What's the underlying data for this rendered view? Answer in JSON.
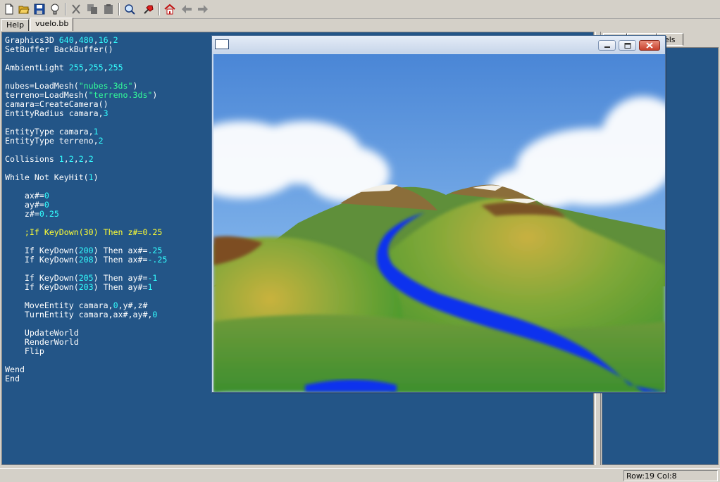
{
  "toolbar": {
    "buttons": [
      "new-file-icon",
      "open-folder-icon",
      "save-icon",
      "lightbulb-icon",
      "cut-icon",
      "copy-icon",
      "paste-icon",
      "find-icon",
      "run-icon",
      "home-icon",
      "back-arrow-icon",
      "forward-arrow-icon"
    ]
  },
  "tabs": [
    {
      "label": "Help"
    },
    {
      "label": "vuelo.bb"
    }
  ],
  "right_panel": {
    "tab_label": "bels"
  },
  "editor": {
    "lines": [
      [
        {
          "t": "Graphics3D ",
          "c": "kw"
        },
        {
          "t": "640",
          "c": "num"
        },
        {
          "t": ",",
          "c": "kw"
        },
        {
          "t": "480",
          "c": "num"
        },
        {
          "t": ",",
          "c": "kw"
        },
        {
          "t": "16",
          "c": "num"
        },
        {
          "t": ",",
          "c": "kw"
        },
        {
          "t": "2",
          "c": "num"
        }
      ],
      [
        {
          "t": "SetBuffer BackBuffer()",
          "c": "kw"
        }
      ],
      [],
      [
        {
          "t": "AmbientLight ",
          "c": "kw"
        },
        {
          "t": "255",
          "c": "num"
        },
        {
          "t": ",",
          "c": "kw"
        },
        {
          "t": "255",
          "c": "num"
        },
        {
          "t": ",",
          "c": "kw"
        },
        {
          "t": "255",
          "c": "num"
        }
      ],
      [],
      [
        {
          "t": "nubes=LoadMesh(",
          "c": "kw"
        },
        {
          "t": "\"nubes.3ds\"",
          "c": "str"
        },
        {
          "t": ")",
          "c": "kw"
        }
      ],
      [
        {
          "t": "terreno=LoadMesh(",
          "c": "kw"
        },
        {
          "t": "\"terreno.3ds\"",
          "c": "str"
        },
        {
          "t": ")",
          "c": "kw"
        }
      ],
      [
        {
          "t": "camara=CreateCamera()",
          "c": "kw"
        }
      ],
      [
        {
          "t": "EntityRadius camara,",
          "c": "kw"
        },
        {
          "t": "3",
          "c": "num"
        }
      ],
      [],
      [
        {
          "t": "EntityType camara,",
          "c": "kw"
        },
        {
          "t": "1",
          "c": "num"
        }
      ],
      [
        {
          "t": "EntityType terreno,",
          "c": "kw"
        },
        {
          "t": "2",
          "c": "num"
        }
      ],
      [],
      [
        {
          "t": "Collisions ",
          "c": "kw"
        },
        {
          "t": "1",
          "c": "num"
        },
        {
          "t": ",",
          "c": "kw"
        },
        {
          "t": "2",
          "c": "num"
        },
        {
          "t": ",",
          "c": "kw"
        },
        {
          "t": "2",
          "c": "num"
        },
        {
          "t": ",",
          "c": "kw"
        },
        {
          "t": "2",
          "c": "num"
        }
      ],
      [],
      [
        {
          "t": "While Not KeyHit(",
          "c": "kw"
        },
        {
          "t": "1",
          "c": "num"
        },
        {
          "t": ")",
          "c": "kw"
        }
      ],
      [],
      [
        {
          "t": "    ax#=",
          "c": "kw"
        },
        {
          "t": "0",
          "c": "num"
        }
      ],
      [
        {
          "t": "    ay#=",
          "c": "kw"
        },
        {
          "t": "0",
          "c": "num"
        }
      ],
      [
        {
          "t": "    z#=",
          "c": "kw"
        },
        {
          "t": "0.25",
          "c": "num"
        }
      ],
      [],
      [
        {
          "t": "    ;If KeyDown(30) Then z#=0.25",
          "c": "cmt"
        }
      ],
      [],
      [
        {
          "t": "    If KeyDown(",
          "c": "kw"
        },
        {
          "t": "200",
          "c": "num"
        },
        {
          "t": ") Then ax#=",
          "c": "kw"
        },
        {
          "t": ".25",
          "c": "num"
        }
      ],
      [
        {
          "t": "    If KeyDown(",
          "c": "kw"
        },
        {
          "t": "208",
          "c": "num"
        },
        {
          "t": ") Then ax#=",
          "c": "kw"
        },
        {
          "t": "-.25",
          "c": "num"
        }
      ],
      [],
      [
        {
          "t": "    If KeyDown(",
          "c": "kw"
        },
        {
          "t": "205",
          "c": "num"
        },
        {
          "t": ") Then ay#=",
          "c": "kw"
        },
        {
          "t": "-1",
          "c": "num"
        }
      ],
      [
        {
          "t": "    If KeyDown(",
          "c": "kw"
        },
        {
          "t": "203",
          "c": "num"
        },
        {
          "t": ") Then ay#=",
          "c": "kw"
        },
        {
          "t": "1",
          "c": "num"
        }
      ],
      [],
      [
        {
          "t": "    MoveEntity camara,",
          "c": "kw"
        },
        {
          "t": "0",
          "c": "num"
        },
        {
          "t": ",y#,z#",
          "c": "kw"
        }
      ],
      [
        {
          "t": "    TurnEntity camara,ax#,ay#,",
          "c": "kw"
        },
        {
          "t": "0",
          "c": "num"
        }
      ],
      [],
      [
        {
          "t": "    UpdateWorld",
          "c": "kw"
        }
      ],
      [
        {
          "t": "    RenderWorld",
          "c": "kw"
        }
      ],
      [
        {
          "t": "    Flip",
          "c": "kw"
        }
      ],
      [],
      [
        {
          "t": "Wend",
          "c": "kw"
        }
      ],
      [
        {
          "t": "End",
          "c": "kw"
        }
      ]
    ]
  },
  "status": {
    "position": "Row:19 Col:8"
  },
  "colors": {
    "editor_bg": "#235587",
    "keyword": "#ffffff",
    "number": "#33ffff",
    "string": "#33ff99",
    "comment": "#ffff33"
  },
  "graphics_window": {
    "icons": [
      "window-icon",
      "minimize-icon",
      "maximize-icon",
      "close-icon"
    ]
  }
}
